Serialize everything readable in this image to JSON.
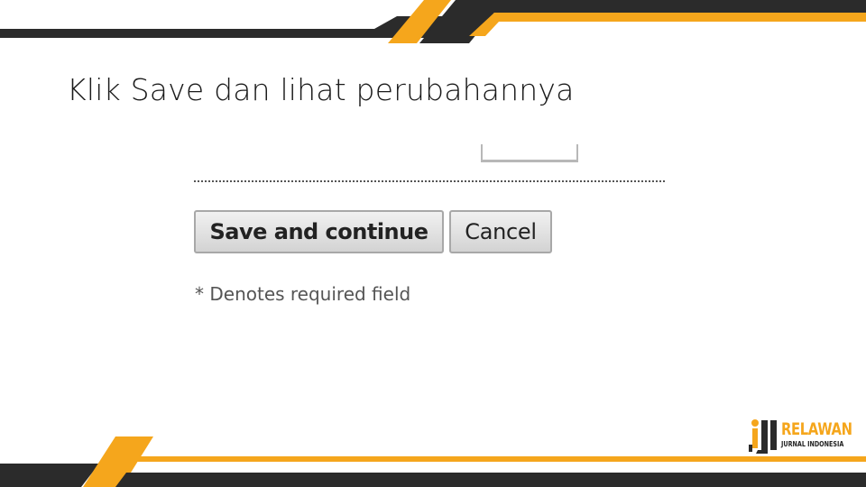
{
  "slide": {
    "title": "Klik Save dan lihat perubahannya"
  },
  "form": {
    "save_label": "Save and continue",
    "cancel_label": "Cancel",
    "required_note": "* Denotes required field"
  },
  "logo": {
    "word": "RELAWAN",
    "sub": "JURNAL INDONESIA"
  },
  "colors": {
    "accent": "#f5a61c",
    "dark": "#2b2b2b",
    "button_border": "#a8a8a8"
  }
}
